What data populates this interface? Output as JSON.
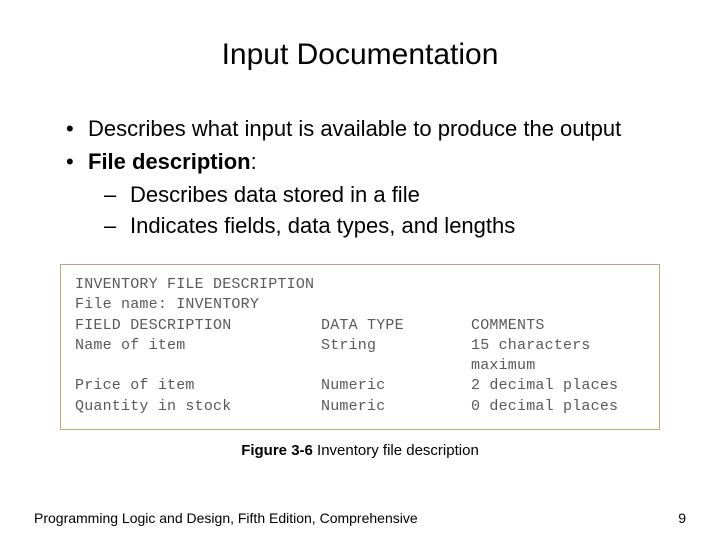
{
  "title": "Input Documentation",
  "bullets": {
    "b1": "Describes what input is available to produce the output",
    "b2_prefix": "File description",
    "b2_suffix": ":",
    "s1": "Describes data stored in a file",
    "s2": "Indicates fields, data types, and lengths"
  },
  "figure": {
    "line1": "INVENTORY FILE DESCRIPTION",
    "line2": "File name: INVENTORY",
    "hdr_a": "FIELD DESCRIPTION",
    "hdr_b": "DATA TYPE",
    "hdr_c": "COMMENTS",
    "r1a": "Name of item",
    "r1b": "String",
    "r1c": "15 characters maximum",
    "r2a": "Price of item",
    "r2b": "Numeric",
    "r2c": "2 decimal places",
    "r3a": "Quantity in stock",
    "r3b": "Numeric",
    "r3c": "0 decimal places"
  },
  "caption": {
    "number": "Figure 3-6",
    "text": "  Inventory file description"
  },
  "footer": {
    "left": "Programming Logic and Design, Fifth Edition, Comprehensive",
    "right": "9"
  }
}
